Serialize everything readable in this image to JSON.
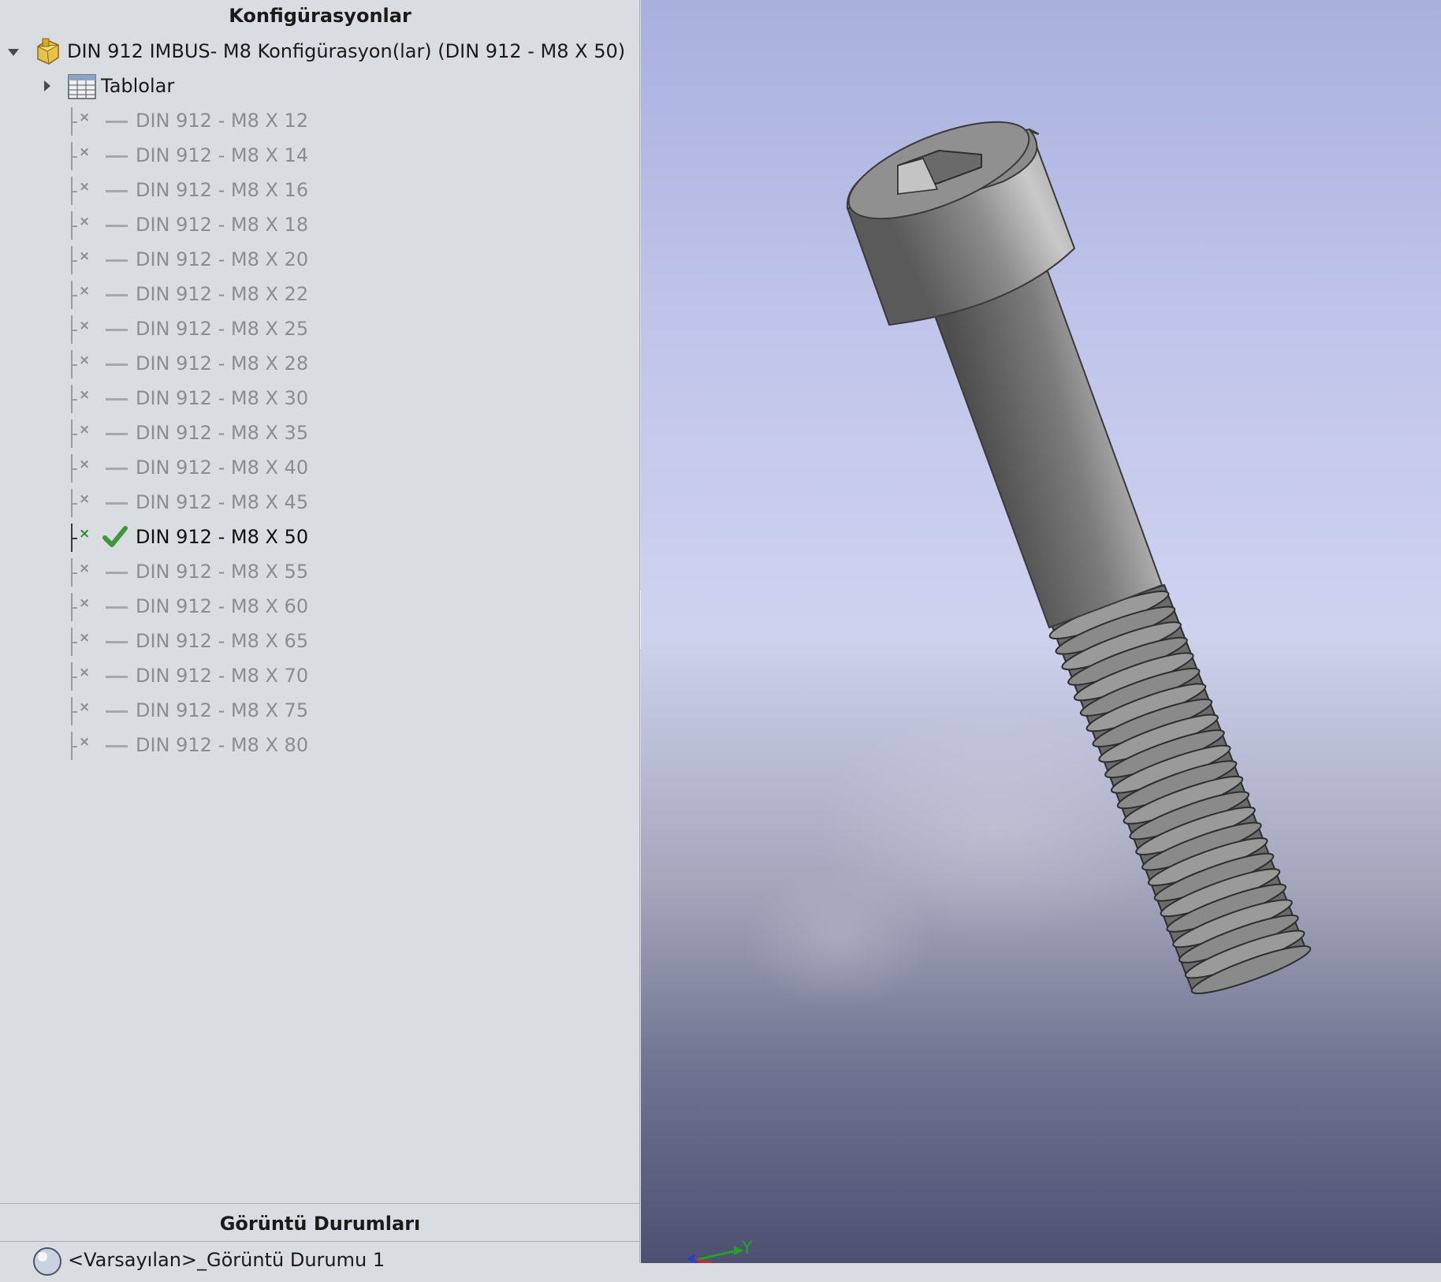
{
  "configuration_panel": {
    "title": "Konfigürasyonlar",
    "root_label": "DIN 912 IMBUS- M8 Konfigürasyon(lar)  (DIN 912 - M8 X 50)",
    "tables_label": "Tablolar",
    "configurations": [
      {
        "label": "DIN 912 - M8 X 12",
        "active": false
      },
      {
        "label": "DIN 912 - M8 X 14",
        "active": false
      },
      {
        "label": "DIN 912 - M8 X 16",
        "active": false
      },
      {
        "label": "DIN 912 - M8 X 18",
        "active": false
      },
      {
        "label": "DIN 912 - M8 X 20",
        "active": false
      },
      {
        "label": "DIN 912 - M8 X 22",
        "active": false
      },
      {
        "label": "DIN 912 - M8 X 25",
        "active": false
      },
      {
        "label": "DIN 912 - M8 X 28",
        "active": false
      },
      {
        "label": "DIN 912 - M8 X 30",
        "active": false
      },
      {
        "label": "DIN 912 - M8 X 35",
        "active": false
      },
      {
        "label": "DIN 912 - M8 X 40",
        "active": false
      },
      {
        "label": "DIN 912 - M8 X 45",
        "active": false
      },
      {
        "label": "DIN 912 - M8 X 50",
        "active": true
      },
      {
        "label": "DIN 912 - M8 X 55",
        "active": false
      },
      {
        "label": "DIN 912 - M8 X 60",
        "active": false
      },
      {
        "label": "DIN 912 - M8 X 65",
        "active": false
      },
      {
        "label": "DIN 912 - M8 X 70",
        "active": false
      },
      {
        "label": "DIN 912 - M8 X 75",
        "active": false
      },
      {
        "label": "DIN 912 - M8 X 80",
        "active": false
      }
    ]
  },
  "display_states_panel": {
    "title": "Görüntü Durumları",
    "item_label": "<Varsayılan>_Görüntü Durumu 1"
  },
  "viewport": {
    "triad_axis_label": "Y",
    "model_icon": "hex-socket-screw-model"
  },
  "colors": {
    "panel_bg": "#d9dce1",
    "inactive_text": "#8a8d92",
    "active_check": "#3a9a3a",
    "part_icon": "#e8c24a"
  }
}
